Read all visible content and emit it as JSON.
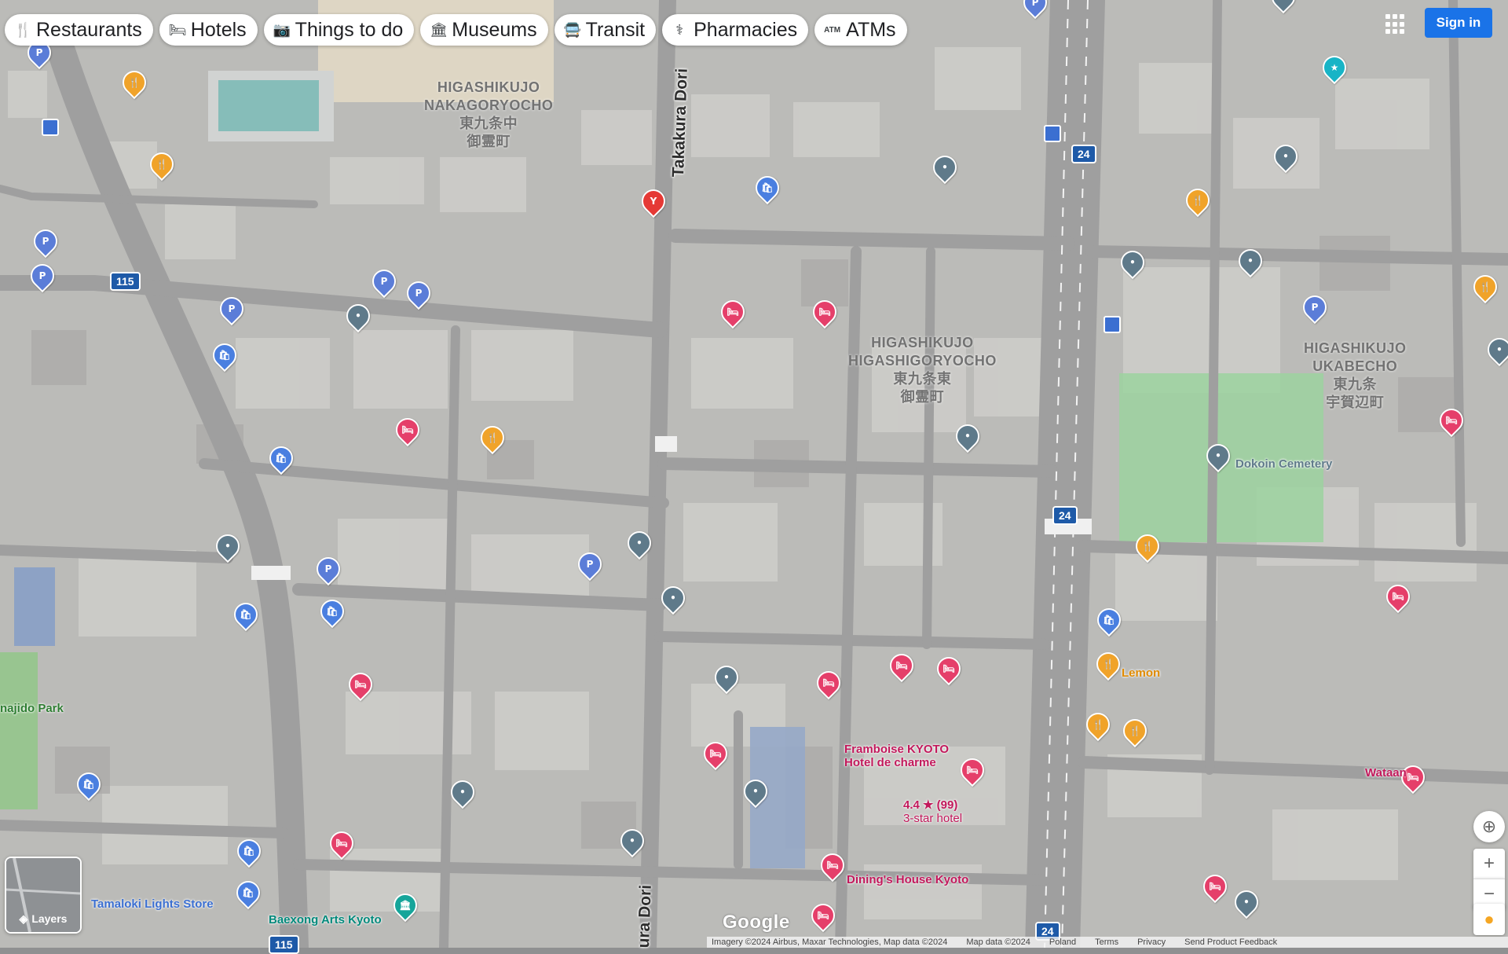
{
  "chips": [
    {
      "icon": "fork-knife-icon",
      "glyph": "🍴",
      "label": "Restaurants"
    },
    {
      "icon": "bed-icon",
      "glyph": "🛏",
      "label": "Hotels"
    },
    {
      "icon": "camera-icon",
      "glyph": "📷",
      "label": "Things to do"
    },
    {
      "icon": "museum-icon",
      "glyph": "🏛",
      "label": "Museums"
    },
    {
      "icon": "bus-icon",
      "glyph": "🚍",
      "label": "Transit"
    },
    {
      "icon": "pharmacy-icon",
      "glyph": "⚕",
      "label": "Pharmacies"
    },
    {
      "icon": "atm-icon",
      "glyph": "ATM",
      "label": "ATMs"
    }
  ],
  "header": {
    "sign_in": "Sign in"
  },
  "streets": {
    "takakura_top": "Takakura Dori",
    "takakura_bottom": "ura Dori",
    "route_24": "24",
    "route_115": "115"
  },
  "areas": {
    "nakagoryocho": [
      "HIGASHIKUJO",
      "NAKAGORYOCHO",
      "東九条中",
      "御霊町"
    ],
    "higashigoryocho": [
      "HIGASHIKUJO",
      "HIGASHIGORYOCHO",
      "東九条東",
      "御霊町"
    ],
    "ukabecho": [
      "HIGASHIKUJO",
      "UKABECHO",
      "東九条",
      "宇賀辺町"
    ]
  },
  "pois": {
    "cemetery": "Dokoin Cemetery",
    "jido_park": "najido Park",
    "house_kyoto": "Dining's House Kyoto",
    "framboise": "Framboise KYOTO\nHotel de charme",
    "lemon": "Lemon",
    "wataan": "Wataan",
    "baexong": "Baexong Arts Kyoto",
    "tamaloki": "Tamaloki Lights Store",
    "hotel_rating": "4.4 ★ (99)",
    "hotel_rating_sub": "3-star hotel"
  },
  "controls": {
    "layers": "Layers"
  },
  "footer": {
    "google": "Google",
    "imagery": "Imagery ©2024 Airbus, Maxar Technologies, Map data ©2024",
    "map_data": "Map data ©2024",
    "country": "Poland",
    "terms": "Terms",
    "privacy": "Privacy",
    "feedback": "Send Product Feedback"
  },
  "colors": {
    "signin": "#1a73e8",
    "parking_pin": "#5b7dd8",
    "hotel_pin": "#e53f6a",
    "food_pin": "#f0a32a",
    "generic_pin": "#5f7a8a"
  }
}
